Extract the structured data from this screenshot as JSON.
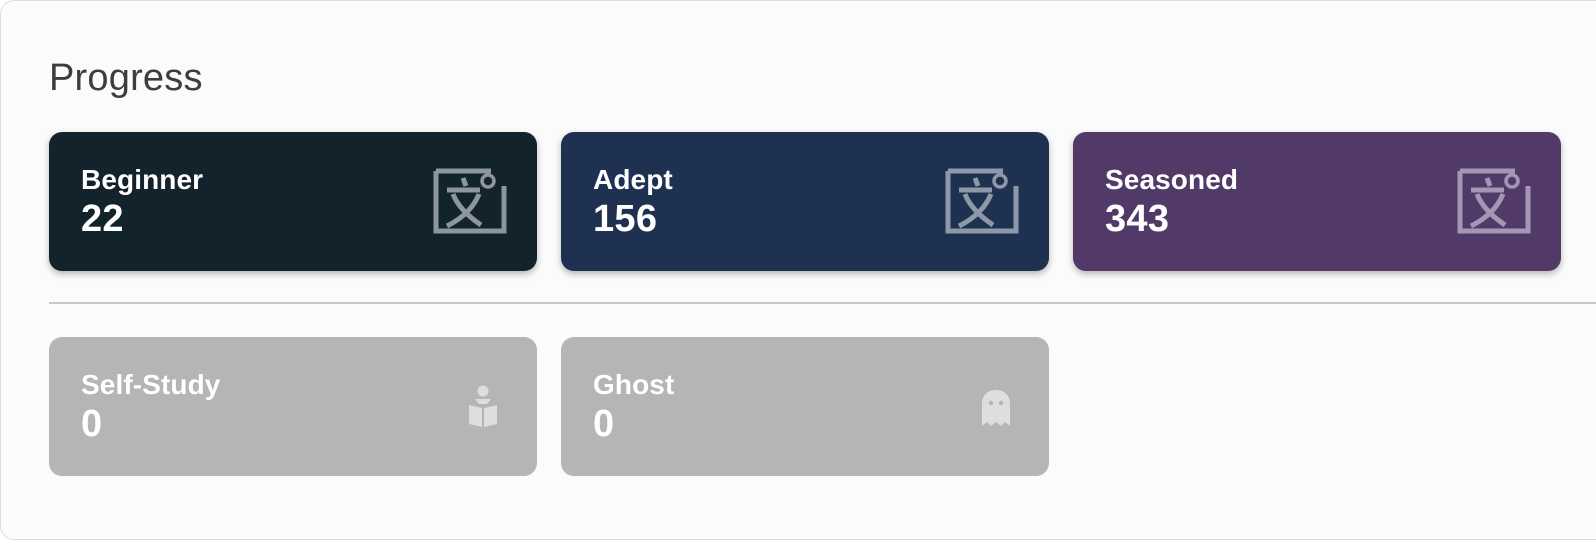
{
  "title": "Progress",
  "levels": [
    {
      "label": "Beginner",
      "value": "22",
      "color": "#13232b",
      "icon": "kanji-icon"
    },
    {
      "label": "Adept",
      "value": "156",
      "color": "#1e3150",
      "icon": "kanji-icon"
    },
    {
      "label": "Seasoned",
      "value": "343",
      "color": "#523a68",
      "icon": "kanji-icon"
    }
  ],
  "other": [
    {
      "label": "Self-Study",
      "value": "0",
      "color": "#b5b5b5",
      "icon": "reader-icon"
    },
    {
      "label": "Ghost",
      "value": "0",
      "color": "#b5b5b5",
      "icon": "ghost-icon"
    }
  ]
}
